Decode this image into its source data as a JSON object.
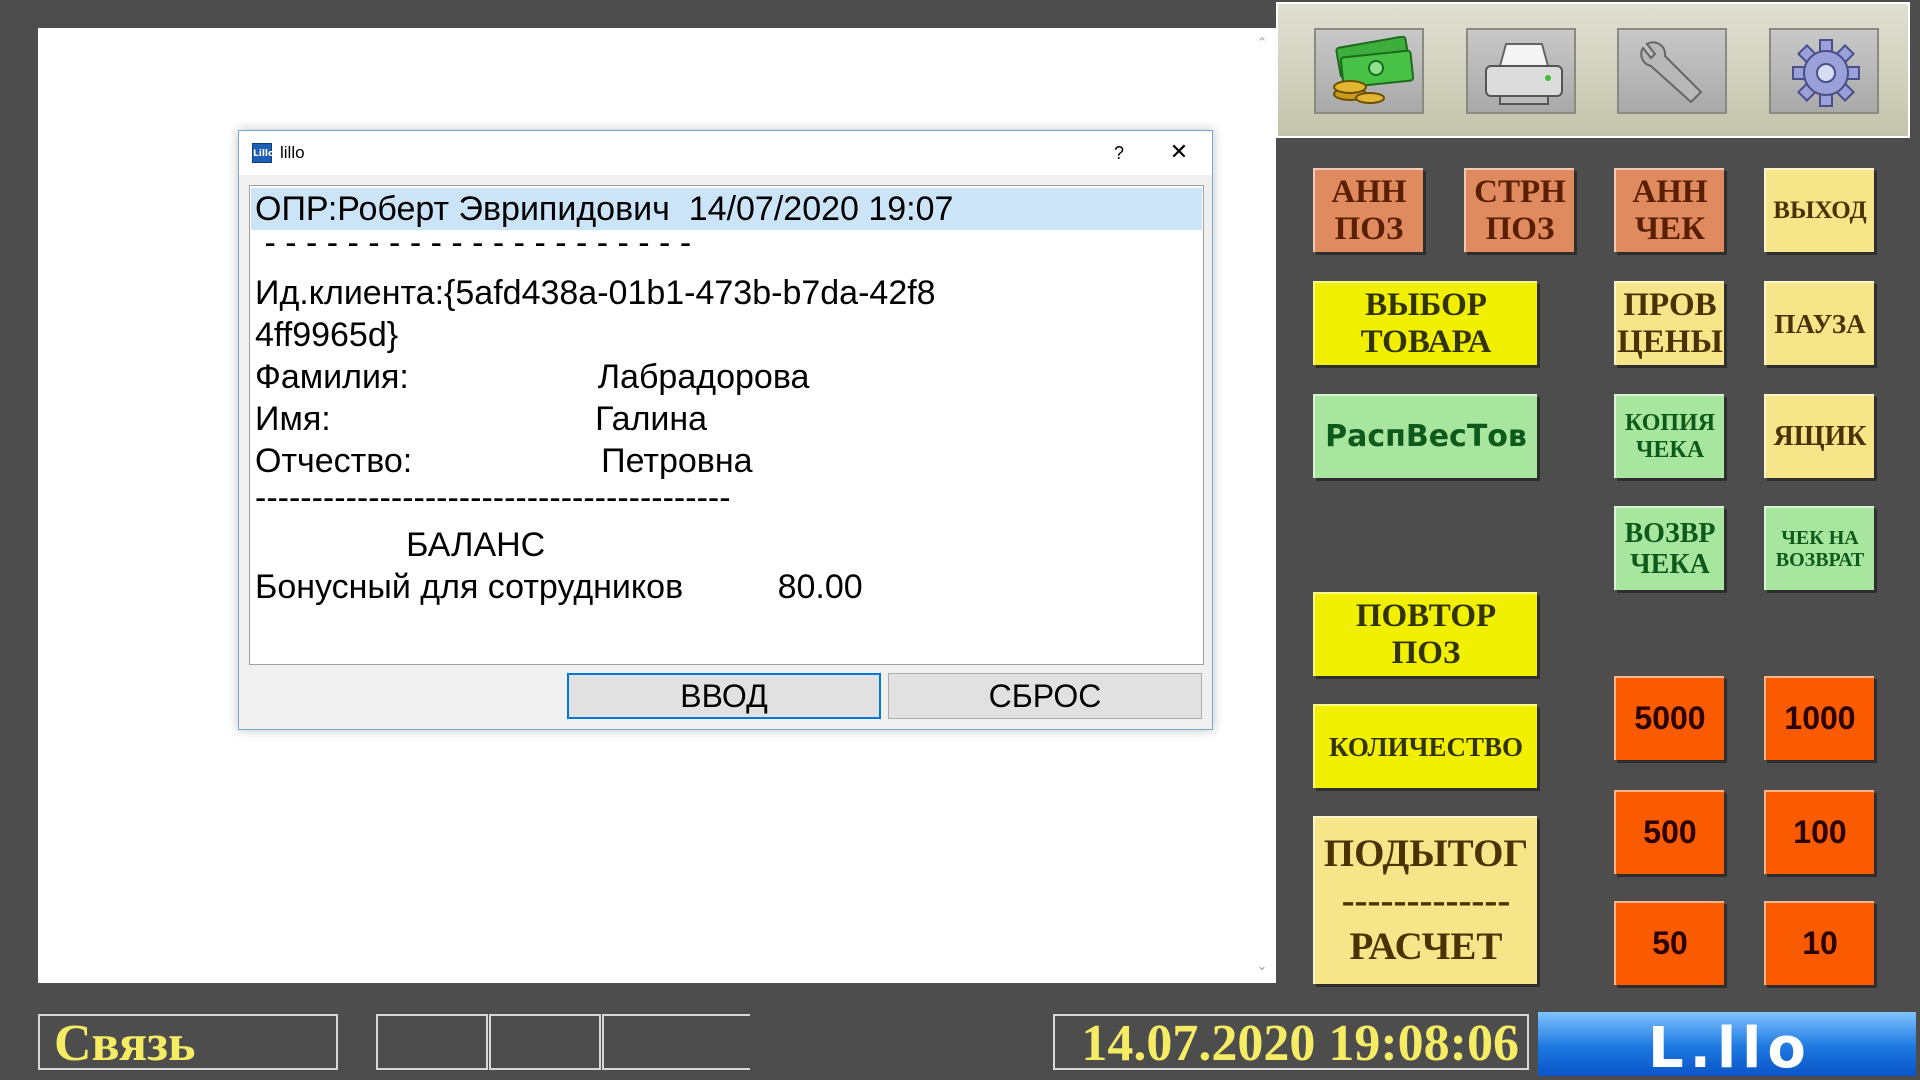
{
  "dialog": {
    "title": "lillo",
    "help_label": "?",
    "close_label": "✕",
    "lines": [
      "ОПР:Роберт Эврипидович  14/07/2020 19:07",
      " - - - - - - - - - - - - - - - - - - - - -",
      "Ид.клиента:{5afd438a-01b1-473b-b7da-42f8",
      "4ff9965d}",
      "Фамилия:                    Лабрадорова",
      "Имя:                            Галина",
      "Отчество:                    Петровна",
      "------------------------------------------",
      "                БАЛАНС",
      "Бонусный для сотрудников          80.00"
    ],
    "enter_label": "ВВОД",
    "reset_label": "СБРОС"
  },
  "toolbar": {
    "icons": [
      "money-icon",
      "printer-icon",
      "wrench-icon",
      "gear-icon"
    ]
  },
  "keys": {
    "ann_pos": "АНН\nПОЗ",
    "strn_pos": "СТРН\nПОЗ",
    "ann_check": "АНН\nЧЕК",
    "exit": "ВЫХОД",
    "select_goods": "ВЫБОР\nТОВАРА",
    "check_price": "ПРОВ\nЦЕНЫ",
    "pause": "ПАУЗА",
    "weight_goods": "РаспВесТов",
    "check_copy": "КОПИЯ\nЧЕКА",
    "drawer": "ЯЩИК",
    "return_check": "ВОЗВР\nЧЕКА",
    "check_for_return": "ЧЕК НА\nВОЗВРАТ",
    "repeat_pos": "ПОВТОР\nПОЗ",
    "quantity": "КОЛИЧЕСТВО",
    "subtotal": "ПОДЫТОГ\n-------------\nРАСЧЕТ",
    "n5000": "5000",
    "n1000": "1000",
    "n500": "500",
    "n100": "100",
    "n50": "50",
    "n10": "10"
  },
  "status": {
    "link": "Связь",
    "datetime": "14.07.2020 19:08:06",
    "logo": "L.llo"
  },
  "colors": {
    "background": "#4d4d4d",
    "salmon": "#df8a5f",
    "yellow": "#f0f000",
    "light_yellow": "#f7e58a",
    "green": "#a8e6a0",
    "orange": "#fa5a00",
    "status_text": "#f5ec64"
  }
}
